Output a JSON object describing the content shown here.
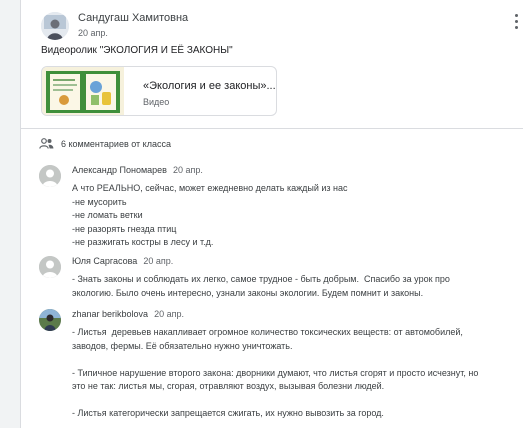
{
  "post": {
    "author": "Сандугаш Хамитовна",
    "date": "20 апр.",
    "text": "Видеоролик \"ЭКОЛОГИЯ И ЕЁ ЗАКОНЫ\"",
    "attachment": {
      "title": "«Экология и ее законы»....",
      "type": "Видео"
    }
  },
  "class_comments": {
    "label": "6 комментариев от класса",
    "icon": "people-icon"
  },
  "comments": [
    {
      "author": "Александр Пономарев",
      "date": "20 апр.",
      "text": "А что РЕАЛЬНО, сейчас, может ежедневно делать каждый из нас\n-не мусорить\n-не ломать ветки\n-не разорять гнезда птиц\n-не разжигать костры в лесу и т.д."
    },
    {
      "author": "Юля Саргасова",
      "date": "20 апр.",
      "text": "- Знать законы и соблюдать их легко, самое трудное - быть добрым.  Спасибо за урок про\nэкологию. Было очень интересно, узнали законы экологии. Будем помнит и законы."
    },
    {
      "author": "zhanar berikbolova",
      "date": "20 апр.",
      "text": "- Листья  деревьев накапливает огромное количество токсических веществ: от автомобилей,\nзаводов, фермы. Её обязательно нужно уничтожать.\n\n- Типичное нарушение второго закона: дворники думают, что листья сгорят и просто исчезнут, но\nэто не так: листья мы, сгорая, отравляют воздух, вызывая болезни людей.\n\n- Листья категорически запрещается сжигать, их нужно вывозить за город."
    }
  ],
  "colors": {
    "text": "#3c4043",
    "secondary": "#5f6368",
    "divider": "#dadce0",
    "background": "#f1f3f4"
  }
}
